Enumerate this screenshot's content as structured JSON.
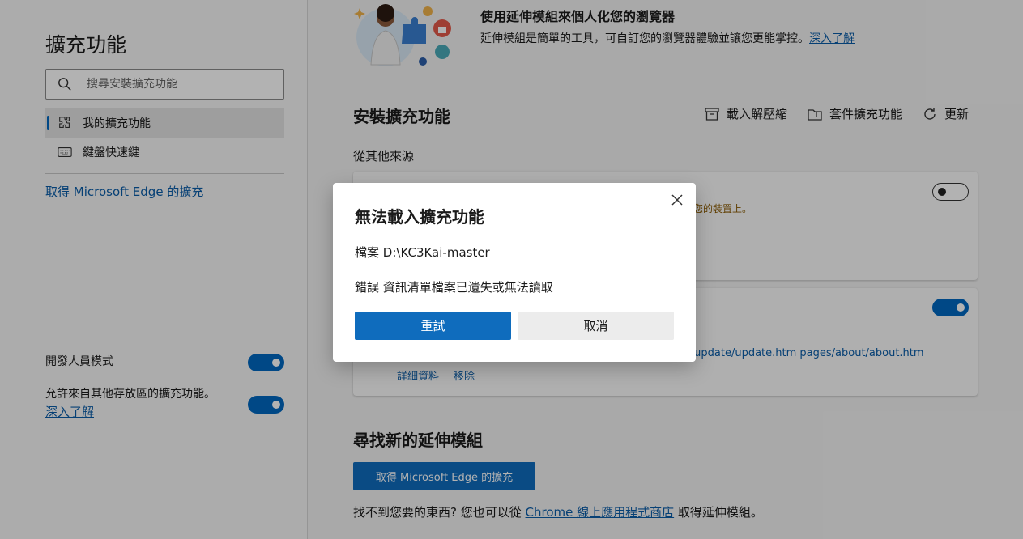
{
  "sidebar": {
    "title": "擴充功能",
    "search_placeholder": "搜尋安裝擴充功能",
    "nav": [
      {
        "label": "我的擴充功能",
        "icon": "puzzle-icon",
        "active": true
      },
      {
        "label": "鍵盤快速鍵",
        "icon": "keyboard-icon",
        "active": false
      }
    ],
    "get_link": "取得 Microsoft Edge 的擴充",
    "dev_mode_label": "開發人員模式",
    "other_stores_label": "允許來自其他存放區的擴充功能。",
    "learn_more": "深入了解"
  },
  "main": {
    "banner_title": "使用延伸模組來個人化您的瀏覽器",
    "banner_desc": "延伸模組是簡單的工具，可自訂您的瀏覽器體驗並讓您更能掌控。",
    "banner_link": "深入了解",
    "section_title": "安裝擴充功能",
    "actions": [
      {
        "label": "載入解壓縮",
        "icon": "archive-icon"
      },
      {
        "label": "套件擴充功能",
        "icon": "package-icon"
      },
      {
        "label": "更新",
        "icon": "refresh-icon"
      }
    ],
    "source_title": "從其他來源",
    "card1_warning": "您的裝置上。",
    "card2_paths": "s/update/update.htm pages/about/about.htm",
    "card2_details": "詳細資料",
    "card2_remove": "移除",
    "find_title": "尋找新的延伸模組",
    "find_button": "取得 Microsoft Edge 的擴充",
    "store_prefix": "找不到您要的東西? 您也可以從",
    "store_link": "Chrome 線上應用程式商店",
    "store_suffix": "取得延伸模組。"
  },
  "dialog": {
    "title": "無法載入擴充功能",
    "file_label": "檔案",
    "file_value": "D:\\KC3Kai-master",
    "error_label": "錯誤",
    "error_value": "資訊清單檔案已遺失或無法讀取",
    "retry": "重試",
    "cancel": "取消"
  },
  "colors": {
    "accent": "#0f6cbd",
    "link": "#0a5ca8",
    "warning": "#8a5a00"
  }
}
